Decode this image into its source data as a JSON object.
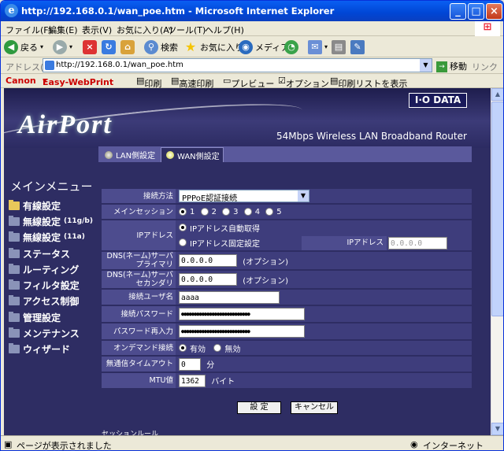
{
  "window": {
    "title": "http://192.168.0.1/wan_poe.htm - Microsoft Internet Explorer"
  },
  "menubar": [
    "ファイル(F)",
    "編集(E)",
    "表示(V)",
    "お気に入り(A)",
    "ツール(T)",
    "ヘルプ(H)"
  ],
  "toolbar": {
    "back": "戻る",
    "search": "検索",
    "favorites": "お気に入り",
    "media": "メディア"
  },
  "address": {
    "label": "アドレス(D)",
    "url": "http://192.168.0.1/wan_poe.htm",
    "go": "移動",
    "links": "リンク"
  },
  "canonbar": {
    "brand": "Canon",
    "product": "Easy-WebPrint",
    "print": "印刷",
    "fast_print": "高速印刷",
    "preview": "プレビュー",
    "options": "オプション",
    "print_list": "印刷リストを表示"
  },
  "header": {
    "logo": "AirPort",
    "vendor": "I·O DATA",
    "subtitle": "54Mbps Wireless LAN Broadband Router"
  },
  "tabs": {
    "lan": "LAN側設定",
    "wan": "WAN側設定"
  },
  "nav": {
    "heading": "メインメニュー",
    "items": [
      "有線設定",
      "無線設定",
      "無線設定",
      "ステータス",
      "ルーティング",
      "フィルタ設定",
      "アクセス制御",
      "管理設定",
      "メンテナンス",
      "ウィザード"
    ],
    "sub_11g": "(11g/b)",
    "sub_11a": "(11a)"
  },
  "form": {
    "method_label": "接続方法",
    "method_value": "PPPoE認証接続",
    "session_label": "メインセッション",
    "session_options": [
      "1",
      "2",
      "3",
      "4",
      "5"
    ],
    "ip_label": "IPアドレス",
    "ip_auto": "IPアドレス自動取得",
    "ip_fixed": "IPアドレス固定設定",
    "ip_field_label": "IPアドレス",
    "ip_field_value": "0.0.0.0",
    "dns1_label": "DNS(ネーム)サーバ",
    "dns1_label2": "プライマリ",
    "dns1_value": "0.0.0.0",
    "dns2_label": "DNS(ネーム)サーバ",
    "dns2_label2": "セカンダリ",
    "dns2_value": "0.0.0.0",
    "optional": "(オプション)",
    "user_label": "接続ユーザ名",
    "user_value": "aaaa",
    "pass_label": "接続パスワード",
    "pass_value": "●●●●●●●●●●●●●●●●●●●●●●●●●●●",
    "pass2_label": "パスワード再入力",
    "pass2_value": "●●●●●●●●●●●●●●●●●●●●●●●●●●●",
    "ondemand_label": "オンデマンド接続",
    "ondemand_on": "有効",
    "ondemand_off": "無効",
    "timeout_label": "無通信タイムアウト",
    "timeout_value": "0",
    "timeout_unit": "分",
    "mtu_label": "MTU値",
    "mtu_value": "1362",
    "mtu_unit": "バイト",
    "submit": "設 定",
    "cancel": "キャンセル",
    "next_section": "セッションルール"
  },
  "status": {
    "text": "ページが表示されました",
    "zone": "インターネット"
  }
}
